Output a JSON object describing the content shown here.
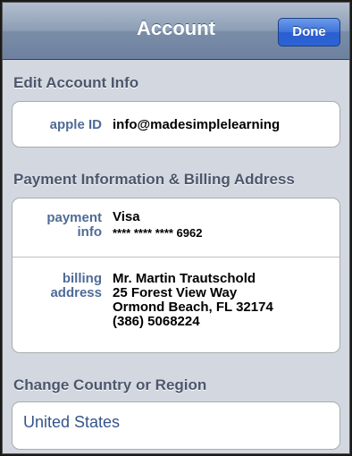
{
  "nav": {
    "title": "Account",
    "done_label": "Done"
  },
  "sections": {
    "edit_account": {
      "header": "Edit Account Info",
      "apple_id_label": "apple ID",
      "apple_id_value": "info@madesimplelearning"
    },
    "payment": {
      "header": "Payment Information & Billing Address",
      "payment_label_1": "payment",
      "payment_label_2": "info",
      "card_type": "Visa",
      "card_number": "**** **** **** 6962",
      "billing_label_1": "billing",
      "billing_label_2": "address",
      "address_lines": [
        "Mr. Martin Trautschold",
        "25 Forest View Way",
        "Ormond Beach, FL 32174",
        "(386) 5068224"
      ]
    },
    "country": {
      "header": "Change Country or Region",
      "value": "United States"
    }
  }
}
